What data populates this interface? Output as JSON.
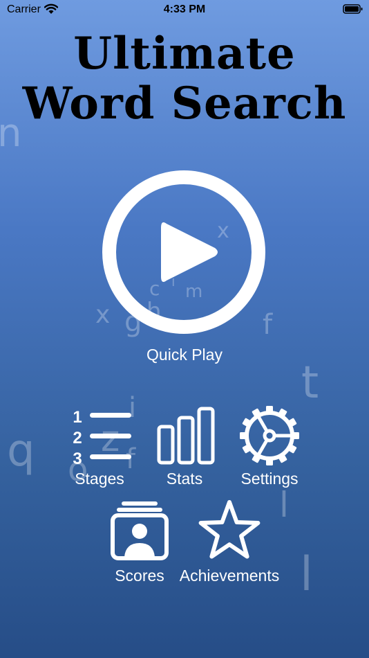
{
  "status_bar": {
    "carrier": "Carrier",
    "time": "4:33 PM"
  },
  "title": {
    "line1": "Ultimate",
    "line2": "Word Search"
  },
  "background_letters": [
    "n",
    "x",
    "c",
    "i",
    "m",
    "x",
    "g",
    "h",
    "f",
    "t",
    "i",
    "z",
    "q",
    "o",
    "f",
    "l",
    "l"
  ],
  "quick_play": {
    "label": "Quick Play",
    "icon": "play-icon"
  },
  "menu": {
    "stages": {
      "label": "Stages",
      "icon": "numbered-list-icon",
      "numbers": [
        "1",
        "2",
        "3"
      ]
    },
    "stats": {
      "label": "Stats",
      "icon": "bar-chart-icon"
    },
    "settings": {
      "label": "Settings",
      "icon": "gear-icon"
    },
    "scores": {
      "label": "Scores",
      "icon": "contact-cards-icon"
    },
    "achievements": {
      "label": "Achievements",
      "icon": "star-icon"
    }
  },
  "colors": {
    "gradient_top": "#6f9be0",
    "gradient_bottom": "#264d87",
    "title": "#000000",
    "foreground": "#ffffff"
  }
}
